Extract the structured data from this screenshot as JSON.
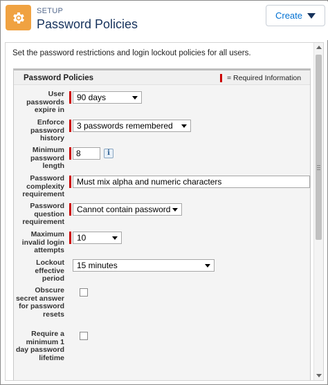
{
  "header": {
    "setup_label": "SETUP",
    "title": "Password Policies",
    "create_label": "Create",
    "setup_icon": "gear-icon",
    "accent": "#f0a241"
  },
  "intro": "Set the password restrictions and login lockout policies for all users.",
  "section": {
    "title": "Password Policies",
    "required_legend": "= Required Information",
    "required_color": "#cc0000"
  },
  "fields": {
    "expire": {
      "label": "User passwords expire in",
      "value": "90 days"
    },
    "history": {
      "label": "Enforce password history",
      "value": "3 passwords remembered"
    },
    "min_length": {
      "label": "Minimum password length",
      "value": "8",
      "info_icon": "i"
    },
    "complexity": {
      "label": "Password complexity requirement",
      "value": "Must mix alpha and numeric characters"
    },
    "question": {
      "label": "Password question requirement",
      "value": "Cannot contain password"
    },
    "max_attempts": {
      "label": "Maximum invalid login attempts",
      "value": "10"
    },
    "lockout": {
      "label": "Lockout effective period",
      "value": "15 minutes"
    },
    "obscure": {
      "label": "Obscure secret answer for password resets",
      "checked": false
    },
    "min_lifetime": {
      "label": "Require a minimum 1 day password lifetime",
      "checked": false
    }
  }
}
